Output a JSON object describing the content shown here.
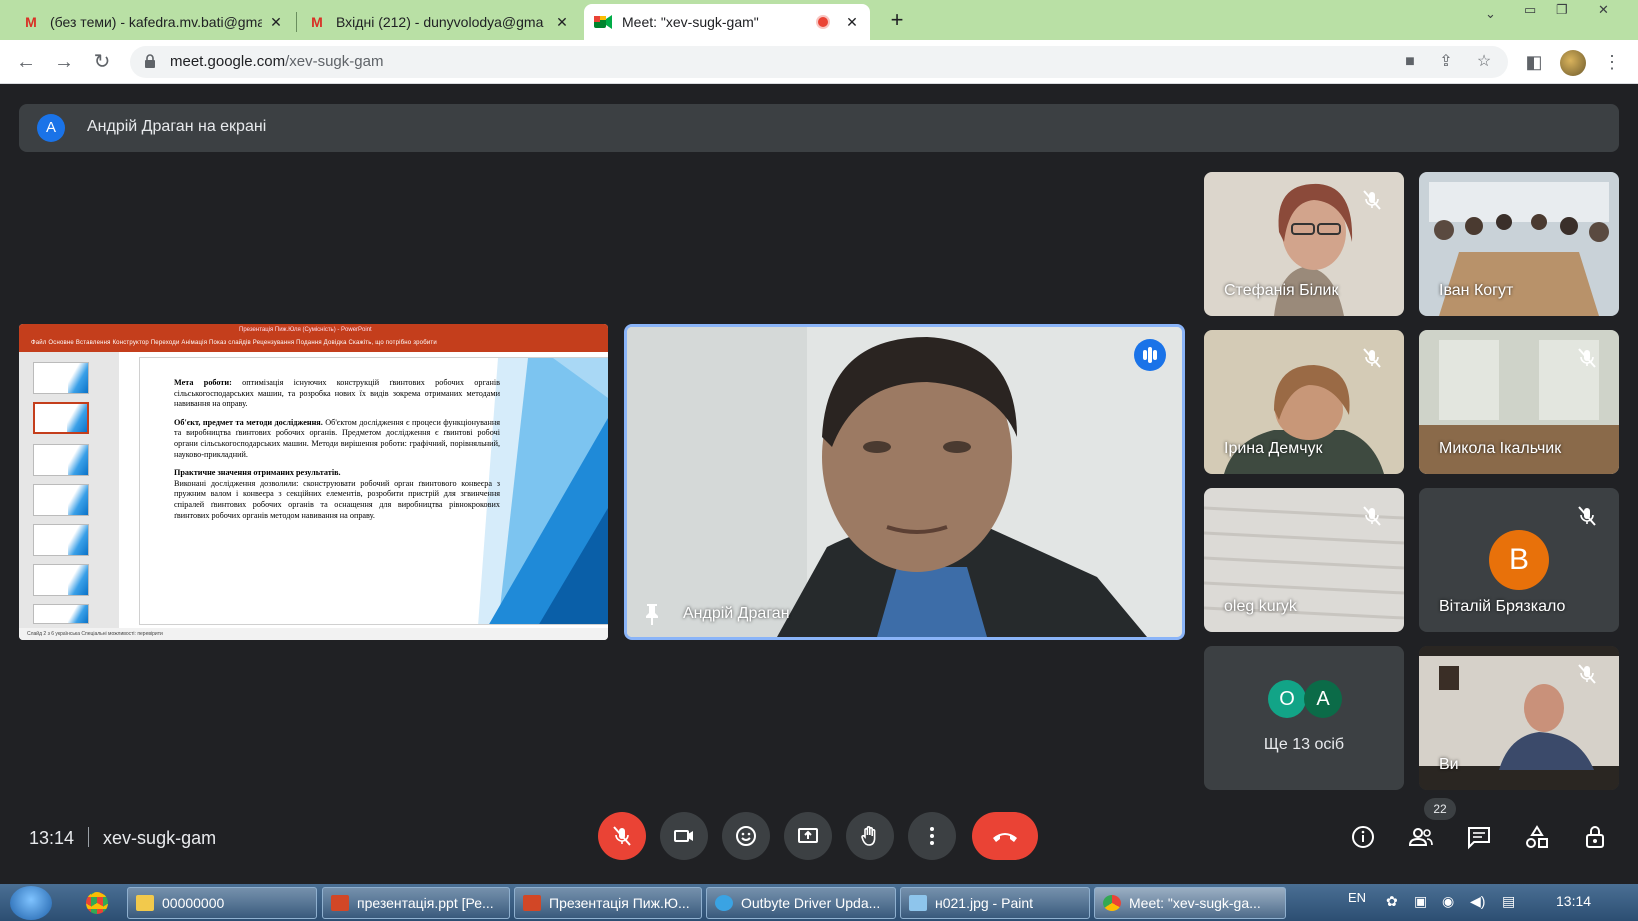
{
  "browser": {
    "tabs": [
      {
        "title": "(без теми) - kafedra.mv.bati@gma",
        "favicon": "gmail-icon"
      },
      {
        "title": "Вхідні (212) - dunyvolodya@gma",
        "favicon": "gmail-icon"
      },
      {
        "title": "Meet: \"xev-sugk-gam\"",
        "favicon": "meet-icon",
        "active": true,
        "recording": true
      }
    ],
    "new_tab": "+",
    "url_host": "meet.google.com",
    "url_path": "/xev-sugk-gam"
  },
  "meet": {
    "banner_avatar": "А",
    "banner_text": "Андрій Драган на екрані",
    "presenter_name": "Андрій Драган",
    "presentation": {
      "app_title": "Презентація Пиж.Юля (Сумісність) - PowerPoint",
      "ribbon_tabs": "Файл   Основне   Вставлення   Конструктор   Переходи   Анімація   Показ слайдів   Рецензування   Подання   Довідка   Скажіть, що потрібно зробити",
      "para1_bold": "Мета роботи:",
      "para1": "оптимізація існуючих конструкцій ґвинтових робочих органів сільськогосподарських машин, та розробка нових їх видів зокрема отриманих методами навивання на оправу.",
      "para2_bold": "Об'єкт, предмет та методи дослідження.",
      "para2": "Об'єктом дослідження є процеси функціонування та виробництва ґвинтових робочих органів. Предметом дослідження є ґвинтові робочі органи сільськогосподарських машин. Методи вирішення роботи: графічний, порівняльний, науково-прикладний.",
      "para3_bold": "Практичне значення отриманих результатів.",
      "para3": "Виконані дослідження дозволили: сконструювати робочий орган ґвинтового конвеєра з пружним валом і конвеєра з секційних елементів, розробити пристрій для згвинчення спіралей ґвинтових робочих органів та оснащення для виробництва рівнокрокових ґвинтових робочих органів методом навивання на оправу.",
      "status": "Слайд 2 з 6   українська   Спеціальні можливості: перевірити"
    },
    "participants": [
      {
        "name": "Стефанія Білик",
        "muted": true
      },
      {
        "name": "Іван Когут",
        "muted": false
      },
      {
        "name": "Ірина Демчук",
        "muted": true
      },
      {
        "name": "Микола Ікальчик",
        "muted": true
      },
      {
        "name": "oleg kuryk",
        "muted": true
      },
      {
        "name": "Віталій Брязкало",
        "muted": true,
        "avatar": "В"
      },
      {
        "name": "Ви",
        "muted": true
      }
    ],
    "more": {
      "avatars": [
        "О",
        "А"
      ],
      "label": "Ще 13 осіб"
    },
    "time": "13:14",
    "meeting_code": "xev-sugk-gam",
    "people_count": "22"
  },
  "taskbar": {
    "buttons": [
      {
        "label": "00000000",
        "icon": "folder-icon"
      },
      {
        "label": "презентація.ppt [Ре...",
        "icon": "powerpoint-icon"
      },
      {
        "label": "Презентація Пиж.Ю...",
        "icon": "powerpoint-icon"
      },
      {
        "label": "Outbyte Driver Upda...",
        "icon": "outbyte-icon"
      },
      {
        "label": "н021.jpg - Paint",
        "icon": "paint-icon"
      },
      {
        "label": "Meet: \"xev-sugk-ga...",
        "icon": "chrome-icon"
      }
    ],
    "lang": "EN",
    "clock": "13:14"
  },
  "colors": {
    "accent": "#1a73e8",
    "danger": "#ea4335",
    "meet_bg": "#202124",
    "tile_bg": "#3c4043",
    "tabstrip": "#b9e0a5"
  }
}
